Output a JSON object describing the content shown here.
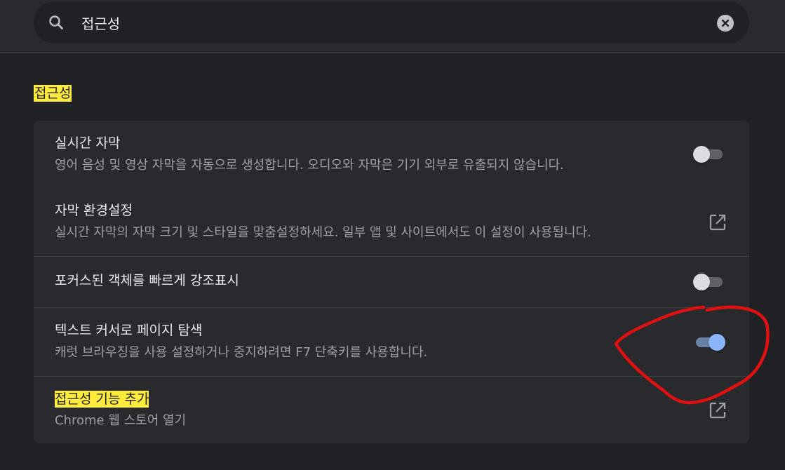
{
  "search": {
    "value": "접근성",
    "icon": "search-icon",
    "clear_icon": "clear-icon"
  },
  "section": {
    "title": "접근성"
  },
  "settings": [
    {
      "title": "실시간 자막",
      "description": "영어 음성 및 영상 자막을 자동으로 생성합니다. 오디오와 자막은 기기 외부로 유출되지 않습니다.",
      "control": "toggle",
      "enabled": false
    },
    {
      "title": "자막 환경설정",
      "description": "실시간 자막의 자막 크기 및 스타일을 맞춤설정하세요. 일부 앱 및 사이트에서도 이 설정이 사용됩니다.",
      "control": "external-link-icon"
    },
    {
      "title": "포커스된 객체를 빠르게 강조표시",
      "control": "toggle",
      "enabled": false
    },
    {
      "title": "텍스트 커서로 페이지 탐색",
      "description": "캐럿 브라우징을 사용 설정하거나 중지하려면 F7 단축키를 사용합니다.",
      "control": "toggle",
      "enabled": true
    },
    {
      "title": "접근성 기능 추가",
      "description": "Chrome 웹 스토어 열기",
      "control": "external-link-icon"
    }
  ],
  "colors": {
    "background": "#202124",
    "card": "#292a2d",
    "highlight": "#ffeb3b",
    "toggle_on": "#8ab4f8",
    "annotation": "#e01010"
  }
}
